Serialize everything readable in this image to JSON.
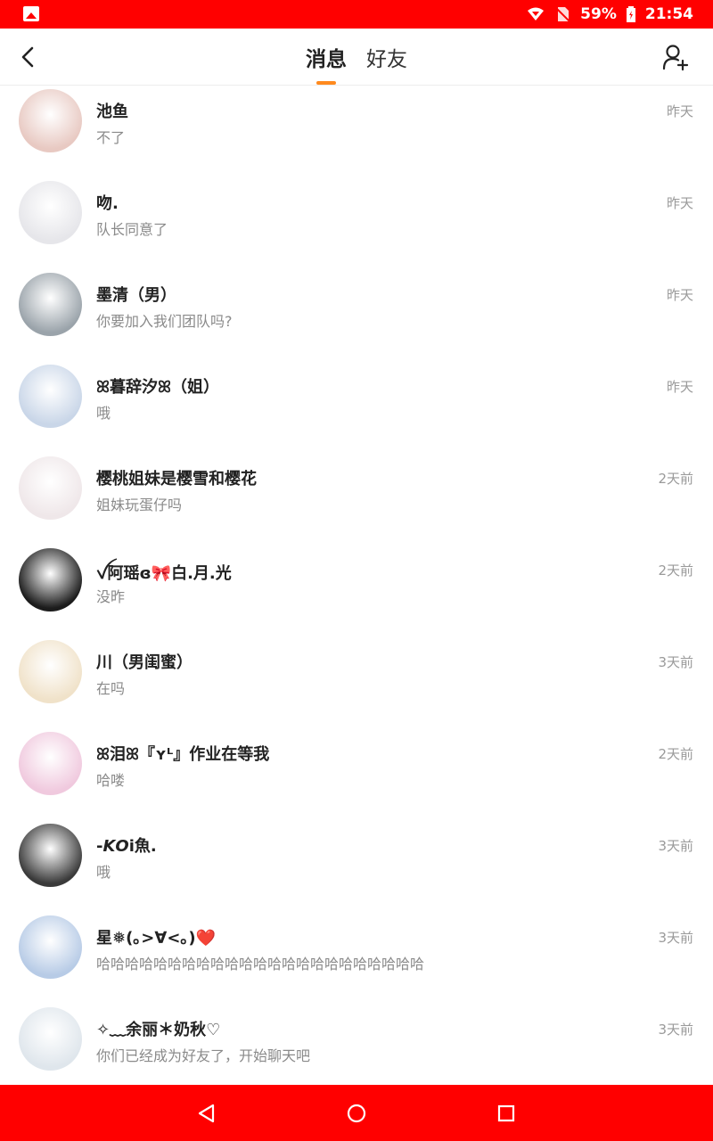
{
  "status_bar": {
    "battery": "59%",
    "time": "21:54"
  },
  "header": {
    "tabs": [
      {
        "label": "消息",
        "active": true
      },
      {
        "label": "好友",
        "active": false
      }
    ]
  },
  "conversations": [
    {
      "name": "池鱼",
      "message": "不了",
      "time": "昨天",
      "avatar_color": "#e8c9c2"
    },
    {
      "name": "吻.",
      "message": "队长同意了",
      "time": "昨天",
      "avatar_color": "#e6e6ea"
    },
    {
      "name": "墨清（男）",
      "message": "你要加入我们团队吗?",
      "time": "昨天",
      "avatar_color": "#9aa3aa"
    },
    {
      "name": "ꕤ暮辞汐ꕤ（姐）",
      "message": "哦",
      "time": "昨天",
      "avatar_color": "#c9d6e8"
    },
    {
      "name": "樱桃姐妹是樱雪和樱花",
      "message": "姐妹玩蛋仔吗",
      "time": "2天前",
      "avatar_color": "#efe7e9"
    },
    {
      "name": "ꪜ阿瑶ɞ🎀白.月.光",
      "message": "没昨",
      "time": "2天前",
      "avatar_color": "#1c1c1c"
    },
    {
      "name": "川（男闺蜜）",
      "message": "在吗",
      "time": "3天前",
      "avatar_color": "#f0e2c9"
    },
    {
      "name": "ꕤ泪ꕤ『ʏᴸ』作业在等我",
      "message": "哈喽",
      "time": "2天前",
      "avatar_color": "#f0c9de"
    },
    {
      "name": "-𝙆𝙊i魚.",
      "message": "哦",
      "time": "3天前",
      "avatar_color": "#3a3a3a"
    },
    {
      "name": "星❅(｡>∀<｡)❤️",
      "message": "哈哈哈哈哈哈哈哈哈哈哈哈哈哈哈哈哈哈哈哈哈哈哈",
      "time": "3天前",
      "avatar_color": "#b7cbe6"
    },
    {
      "name": "✧﹏余丽＊奶秋♡",
      "message": "你们已经成为好友了，开始聊天吧",
      "time": "3天前",
      "avatar_color": "#dfe6ec"
    }
  ]
}
